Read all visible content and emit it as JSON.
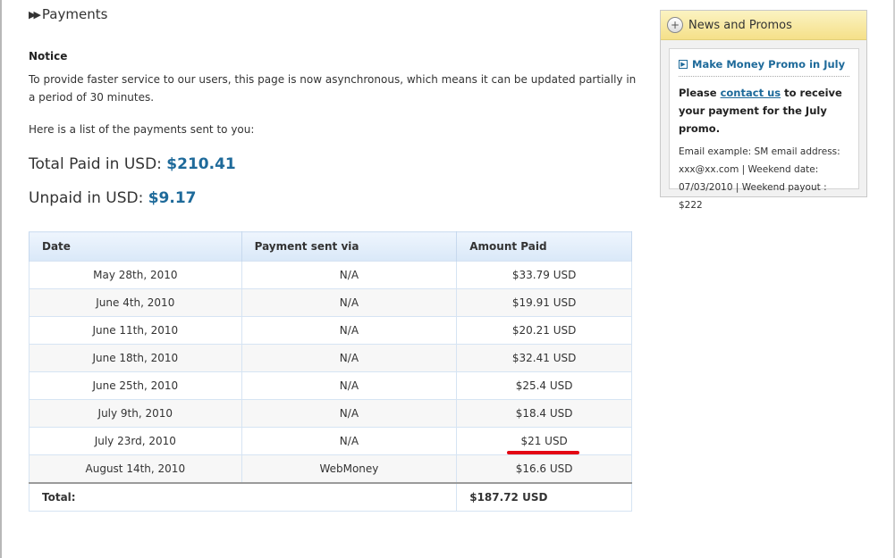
{
  "page": {
    "title": "Payments",
    "notice_title": "Notice",
    "notice_text": "To provide faster service to our users, this page is now asynchronous, which means it can be updated partially in a period of 30 minutes.",
    "list_intro": "Here is a list of the payments sent to you:",
    "total_paid_label": "Total Paid in USD:",
    "total_paid_value": "$210.41",
    "unpaid_label": "Unpaid in USD:",
    "unpaid_value": "$9.17"
  },
  "table": {
    "headers": [
      "Date",
      "Payment sent via",
      "Amount Paid"
    ],
    "rows": [
      [
        "May 28th, 2010",
        "N/A",
        "$33.79 USD"
      ],
      [
        "June 4th, 2010",
        "N/A",
        "$19.91 USD"
      ],
      [
        "June 11th, 2010",
        "N/A",
        "$20.21 USD"
      ],
      [
        "June 18th, 2010",
        "N/A",
        "$32.41 USD"
      ],
      [
        "June 25th, 2010",
        "N/A",
        "$25.4 USD"
      ],
      [
        "July 9th, 2010",
        "N/A",
        "$18.4 USD"
      ],
      [
        "July 23rd, 2010",
        "N/A",
        "$21 USD"
      ],
      [
        "August 14th, 2010",
        "WebMoney",
        "$16.6 USD"
      ]
    ],
    "total_label": "Total:",
    "total_value": "$187.72 USD"
  },
  "sidebar": {
    "title": "News and Promos",
    "header_icon": "plus-circle-icon",
    "promo_link": "Make Money Promo in July",
    "promo_text_before": "Please",
    "promo_contact": "contact us",
    "promo_text_after": "to receive your payment for the July promo.",
    "promo_note": "Email example: SM email address: xxx@xx.com | Weekend date: 07/03/2010 | Weekend payout : $222"
  },
  "colors": {
    "accent": "#1e6a9a",
    "highlight_mark": "#e30613"
  }
}
